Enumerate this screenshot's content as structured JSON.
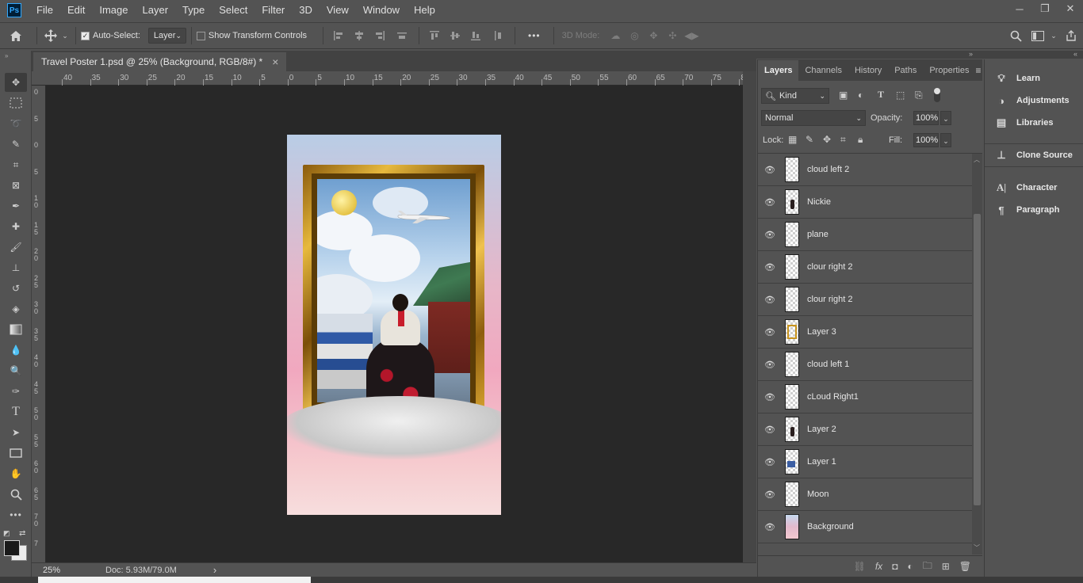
{
  "app": {
    "logo": "Ps"
  },
  "menu": [
    "File",
    "Edit",
    "Image",
    "Layer",
    "Type",
    "Select",
    "Filter",
    "3D",
    "View",
    "Window",
    "Help"
  ],
  "window_controls": {
    "minimize": "─",
    "restore": "❐",
    "close": "✕"
  },
  "options": {
    "auto_select_label": "Auto-Select:",
    "auto_select_checked": true,
    "auto_select_target": "Layer",
    "transform_controls_label": "Show Transform Controls",
    "transform_controls_checked": false,
    "mode_3d_label": "3D Mode:",
    "more_label": "•••"
  },
  "document": {
    "tab_title": "Travel Poster 1.psd @ 25% (Background, RGB/8#) *",
    "close_glyph": "×"
  },
  "ruler": {
    "h_ticks": [
      "40",
      "35",
      "30",
      "25",
      "20",
      "15",
      "10",
      "5",
      "0",
      "5",
      "10",
      "15",
      "20",
      "25",
      "30",
      "35",
      "40",
      "45",
      "50",
      "55",
      "60",
      "65",
      "70",
      "75",
      "8"
    ],
    "v_ticks": [
      "0",
      "5",
      "0",
      "5",
      "1 0",
      "1 5",
      "2 0",
      "2 5",
      "3 0",
      "3 5",
      "4 0",
      "4 5",
      "5 0",
      "5 5",
      "6 0",
      "6 5",
      "7 0",
      "7"
    ]
  },
  "status": {
    "zoom": "25%",
    "doc": "Doc: 5.93M/79.0M",
    "arrow": "›"
  },
  "layers_panel": {
    "tabs": [
      "Layers",
      "Channels",
      "History",
      "Paths",
      "Properties"
    ],
    "active_tab": "Layers",
    "filter_kind": "Kind",
    "blend_mode": "Normal",
    "opacity_label": "Opacity:",
    "opacity_value": "100%",
    "lock_label": "Lock:",
    "fill_label": "Fill:",
    "fill_value": "100%",
    "layers": [
      {
        "name": "cloud left 2",
        "thumb": "transparent"
      },
      {
        "name": "Nickie",
        "thumb": "figure"
      },
      {
        "name": "plane",
        "thumb": "transparent"
      },
      {
        "name": "clour right 2",
        "thumb": "transparent"
      },
      {
        "name": "clour right 2",
        "thumb": "transparent"
      },
      {
        "name": "Layer 3",
        "thumb": "frame"
      },
      {
        "name": "cloud left 1",
        "thumb": "transparent"
      },
      {
        "name": "cLoud Right1",
        "thumb": "transparent"
      },
      {
        "name": "Layer 2",
        "thumb": "figure"
      },
      {
        "name": "Layer 1",
        "thumb": "house"
      },
      {
        "name": "Moon",
        "thumb": "transparent"
      },
      {
        "name": "Background",
        "thumb": "sky"
      }
    ]
  },
  "side_panels": [
    {
      "group": 1,
      "label": "Learn",
      "icon": "lightbulb-icon"
    },
    {
      "group": 1,
      "label": "Adjustments",
      "icon": "adjustments-icon"
    },
    {
      "group": 1,
      "label": "Libraries",
      "icon": "libraries-icon"
    },
    {
      "group": 2,
      "label": "Clone Source",
      "icon": "clone-source-icon"
    },
    {
      "group": 3,
      "label": "Character",
      "icon": "character-icon"
    },
    {
      "group": 3,
      "label": "Paragraph",
      "icon": "paragraph-icon"
    }
  ],
  "colors": {
    "ui_bg": "#535353",
    "canvas_bg": "#282828",
    "accent": "#31a8ff"
  }
}
